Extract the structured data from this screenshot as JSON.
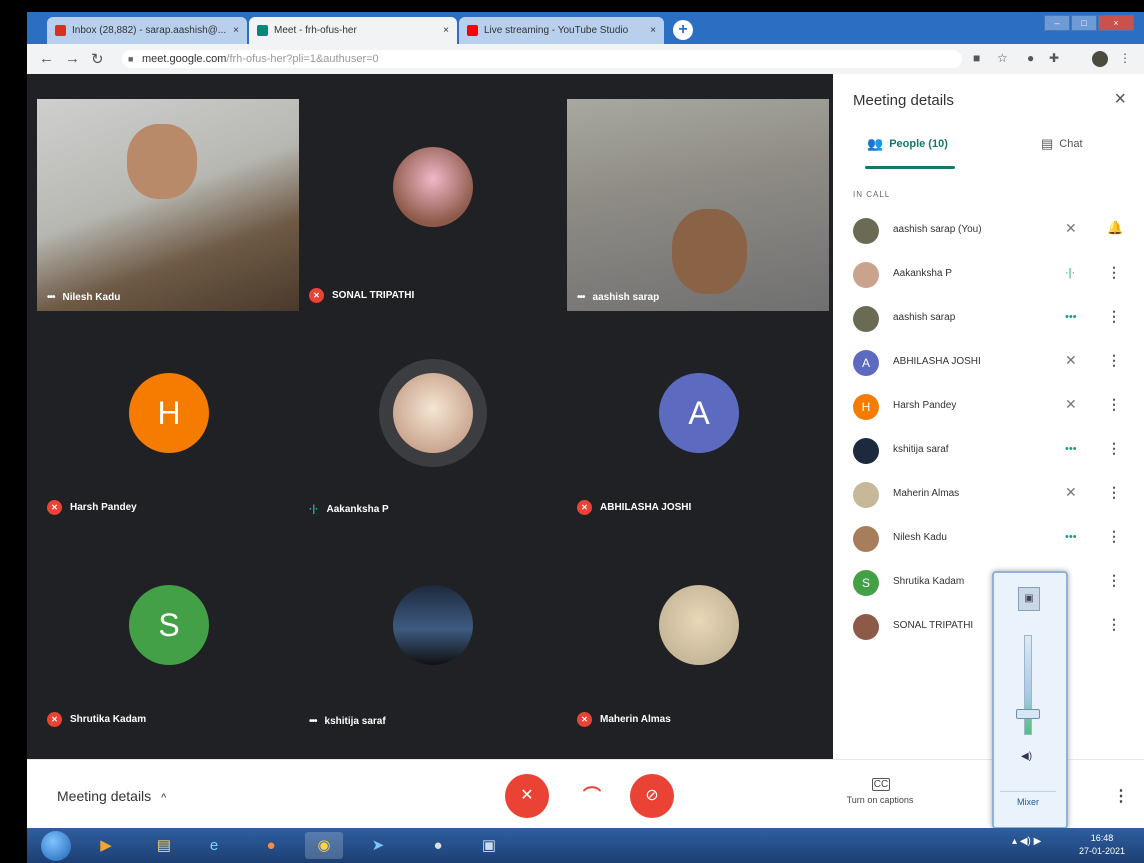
{
  "browser": {
    "tabs": [
      {
        "title": "Inbox (28,882) - sarap.aashish@...",
        "favicon_color": "#d93025",
        "active": false
      },
      {
        "title": "Meet - frh-ofus-her",
        "favicon_color": "#00897b",
        "active": true
      },
      {
        "title": "Live streaming - YouTube Studio",
        "favicon_color": "#ff0000",
        "active": false
      }
    ],
    "new_tab_symbol": "+",
    "url_host": "meet.google.com",
    "url_path": "/frh-ofus-her?pli=1&authuser=0"
  },
  "stage": {
    "tiles": [
      {
        "name": "Nilesh Kadu",
        "status": "talking"
      },
      {
        "name": "SONAL TRIPATHI",
        "status": "muted"
      },
      {
        "name": "aashish sarap",
        "status": "talking"
      },
      {
        "name": "Harsh Pandey",
        "status": "muted",
        "initial": "H"
      },
      {
        "name": "Aakanksha P",
        "status": "speaking"
      },
      {
        "name": "ABHILASHA JOSHI",
        "status": "muted",
        "initial": "A"
      },
      {
        "name": "Shrutika Kadam",
        "status": "muted",
        "initial": "S"
      },
      {
        "name": "kshitija saraf",
        "status": "talking"
      },
      {
        "name": "Maherin Almas",
        "status": "muted"
      }
    ]
  },
  "panel": {
    "title": "Meeting details",
    "close_icon": "×",
    "tab_people": "People (10)",
    "tab_chat": "Chat",
    "section_label": "IN CALL",
    "people": [
      {
        "name": "aashish sarap (You)",
        "initial": "",
        "color": "#6b6b55",
        "status": "muted",
        "action": "bell"
      },
      {
        "name": "Aakanksha P",
        "initial": "",
        "color": "#c9a38d",
        "status": "speaking",
        "action": "more"
      },
      {
        "name": "aashish sarap",
        "initial": "",
        "color": "#6b6b55",
        "status": "talking",
        "action": "more"
      },
      {
        "name": "ABHILASHA JOSHI",
        "initial": "A",
        "color": "#5c6bc0",
        "status": "muted",
        "action": "more"
      },
      {
        "name": "Harsh Pandey",
        "initial": "H",
        "color": "#f57c00",
        "status": "muted",
        "action": "more"
      },
      {
        "name": "kshitija saraf",
        "initial": "",
        "color": "#1d2a3d",
        "status": "talking",
        "action": "more"
      },
      {
        "name": "Maherin Almas",
        "initial": "",
        "color": "#c8b89a",
        "status": "muted",
        "action": "more"
      },
      {
        "name": "Nilesh Kadu",
        "initial": "",
        "color": "#a87d5e",
        "status": "talking",
        "action": "more"
      },
      {
        "name": "Shrutika Kadam",
        "initial": "S",
        "color": "#43a047",
        "status": "",
        "action": "more"
      },
      {
        "name": "SONAL TRIPATHI",
        "initial": "",
        "color": "#8d5a4a",
        "status": "",
        "action": "more"
      }
    ]
  },
  "bottom": {
    "meeting_details": "Meeting details",
    "chevron": "^",
    "captions_label": "Turn on captions",
    "captions_icon": "CC"
  },
  "mixer": {
    "label": "Mixer",
    "level": 0.25
  },
  "taskbar": {
    "time": "16:48",
    "date": "27-01-2021"
  },
  "colors": {
    "accent": "#137a6b",
    "muted_red": "#ea4335",
    "stage_bg": "#202124"
  }
}
